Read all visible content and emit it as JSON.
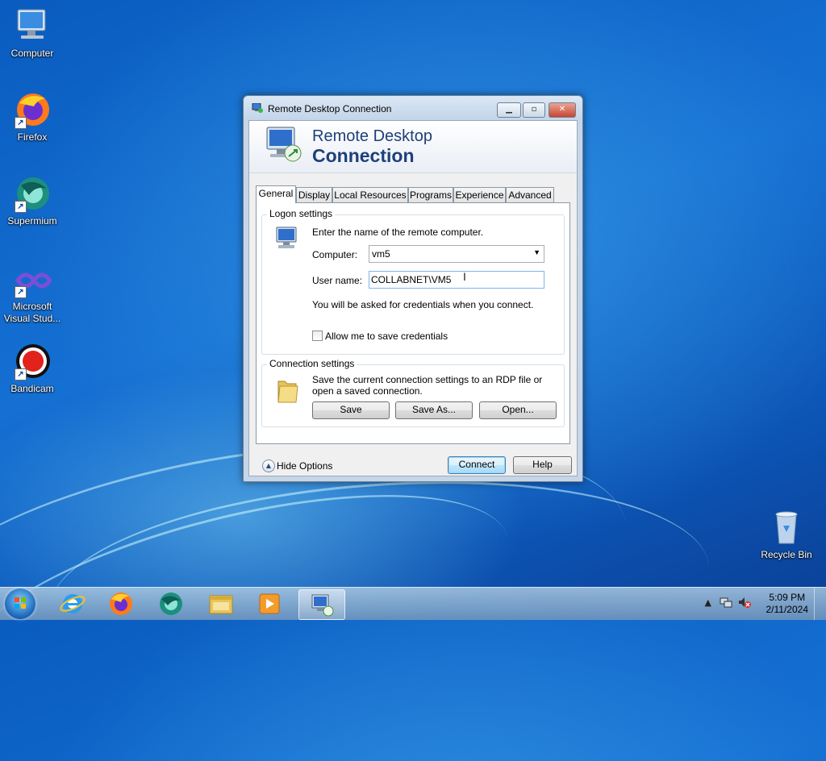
{
  "desktop": {
    "icons": [
      {
        "label": "Computer"
      },
      {
        "label": "Firefox"
      },
      {
        "label": "Supermium"
      },
      {
        "label": "Microsoft Visual Stud..."
      },
      {
        "label": "Bandicam"
      },
      {
        "label": "Recycle Bin"
      }
    ]
  },
  "window": {
    "title": "Remote Desktop Connection",
    "banner_line1": "Remote Desktop",
    "banner_line2": "Connection",
    "tabs": [
      "General",
      "Display",
      "Local Resources",
      "Programs",
      "Experience",
      "Advanced"
    ],
    "active_tab": "General",
    "logon": {
      "legend": "Logon settings",
      "instruction": "Enter the name of the remote computer.",
      "computer_label": "Computer:",
      "computer_value": "vm5",
      "username_label": "User name:",
      "username_value": "COLLABNET\\VM5",
      "credentials_note": "You will be asked for credentials when you connect.",
      "save_credentials_label": "Allow me to save credentials"
    },
    "connection": {
      "legend": "Connection settings",
      "description": "Save the current connection settings to an RDP file or open a saved connection.",
      "save_label": "Save",
      "save_as_label": "Save As...",
      "open_label": "Open..."
    },
    "hide_options_label": "Hide Options",
    "connect_label": "Connect",
    "help_label": "Help"
  },
  "taskbar": {
    "time": "5:09 PM",
    "date": "2/11/2024",
    "pinned": [
      "internet-explorer-icon",
      "firefox-icon",
      "supermium-icon",
      "file-explorer-icon",
      "media-player-icon",
      "remote-desktop-icon"
    ]
  },
  "colors": {
    "banner_text": "#1e3f7a",
    "desktop_blue": "#0d57b8",
    "close_button": "#c9452e"
  }
}
